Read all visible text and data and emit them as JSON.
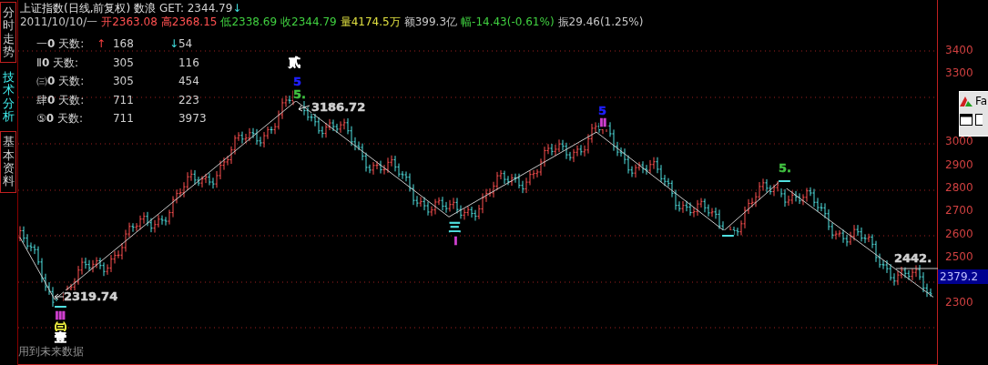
{
  "side_tabs": [
    {
      "label": "分时走势",
      "selected": false
    },
    {
      "label": "技术分析",
      "selected": true
    },
    {
      "label": "基本资料",
      "selected": false
    }
  ],
  "header": {
    "title": "上证指数(日线,前复权) 数浪",
    "get_label": "GET: 2344.79",
    "get_arrow": "↓",
    "fields": [
      {
        "text": "2011/10/10/一",
        "color": "#c8c8c8"
      },
      {
        "text": "开2363.08",
        "color": "#ff5050"
      },
      {
        "text": "高2368.15",
        "color": "#ff5050"
      },
      {
        "text": "低2338.69",
        "color": "#40d040"
      },
      {
        "text": "收2344.79",
        "color": "#40d040"
      },
      {
        "text": "量4174.5万",
        "color": "#e0e040"
      },
      {
        "text": "额399.3亿",
        "color": "#c8c8c8"
      },
      {
        "text": "幅-14.43(-0.61%)",
        "color": "#40d040"
      },
      {
        "text": "振29.46(1.25%)",
        "color": "#c8c8c8"
      }
    ]
  },
  "stats": [
    {
      "label": "一**0** 天数:",
      "up_arrow": "↑",
      "up": "168",
      "down_arrow": "↓",
      "down": "54"
    },
    {
      "label": "Ⅱ**0** 天数:",
      "up": "305",
      "down": "116"
    },
    {
      "label": "㈢**0** 天数:",
      "up": "305",
      "down": "454"
    },
    {
      "label": "肆**0** 天数:",
      "up": "711",
      "down": "223"
    },
    {
      "label": "⑤**0** 天数:",
      "up": "711",
      "down": "3973"
    }
  ],
  "annotations": [
    {
      "text": "贰",
      "color": "#ffffff"
    },
    {
      "text": "5",
      "color": "#2020ff"
    },
    {
      "text": "5.",
      "color": "#40c040"
    },
    {
      "text": "3186.72",
      "color": "#d0d0d0"
    },
    {
      "text": "5",
      "color": "#2020ff"
    },
    {
      "text": "Ⅱ",
      "color": "#d040d0"
    },
    {
      "text": "三",
      "color": "#50e0e0"
    },
    {
      "text": "I",
      "color": "#d040d0"
    },
    {
      "text": "一",
      "color": "#50e0e0"
    },
    {
      "text": "5.",
      "color": "#40c040"
    },
    {
      "text": "一",
      "color": "#50e0e0"
    },
    {
      "text": "2319.74",
      "color": "#d0d0d0"
    },
    {
      "text": "一",
      "color": "#50e0e0"
    },
    {
      "text": "Ⅲ",
      "color": "#d040d0"
    },
    {
      "text": "㈢",
      "color": "#f0f040"
    },
    {
      "text": "壹",
      "color": "#ffffff"
    },
    {
      "text": "2442.",
      "color": "#d0d0d0"
    }
  ],
  "footer_note": "用到未来数据",
  "price_axis": {
    "labels": [
      "3400",
      "3300",
      "3000",
      "2900",
      "2800",
      "2700",
      "2600",
      "2500",
      "2300"
    ],
    "last_price": "2379.2"
  },
  "popup": {
    "title": "Fa"
  }
}
